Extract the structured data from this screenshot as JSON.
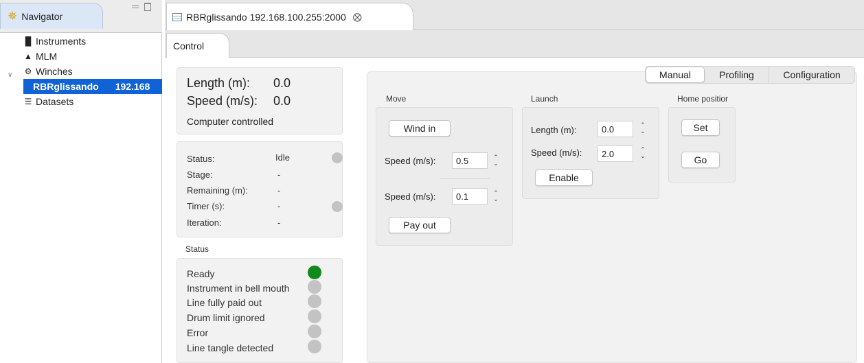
{
  "navigator": {
    "title": "Navigator",
    "items": [
      {
        "label": "Instruments",
        "icon": "bottle-icon"
      },
      {
        "label": "MLM",
        "icon": "scale-icon"
      },
      {
        "label": "Winches",
        "icon": "gears-icon"
      },
      {
        "label": "RBRglissando",
        "ip": "192.168"
      },
      {
        "label": "Datasets",
        "icon": "database-icon"
      }
    ]
  },
  "editor": {
    "tab_title": "RBRglissando 192.168.100.255:2000",
    "control_tab": "Control"
  },
  "readout": {
    "length_label": "Length (m):",
    "length_value": "0.0",
    "speed_label": "Speed (m/s):",
    "speed_value": "0.0",
    "mode": "Computer controlled"
  },
  "status": {
    "status_label": "Status:",
    "status_value": "Idle",
    "stage_label": "Stage:",
    "stage_value": "-",
    "remaining_label": "Remaining (m):",
    "remaining_value": "-",
    "timer_label": "Timer (s):",
    "timer_value": "-",
    "iteration_label": "Iteration:",
    "iteration_value": "-"
  },
  "flags": {
    "heading": "Status",
    "items": [
      {
        "label": "Ready",
        "color": "#118a1b"
      },
      {
        "label": "Instrument in bell mouth",
        "color": "#c3c3c3"
      },
      {
        "label": "Line fully paid out",
        "color": "#c3c3c3"
      },
      {
        "label": "Drum limit ignored",
        "color": "#c3c3c3"
      },
      {
        "label": "Error",
        "color": "#c3c3c3"
      },
      {
        "label": "Line tangle detected",
        "color": "#c3c3c3"
      }
    ]
  },
  "modes": [
    "Manual",
    "Profiling",
    "Configuration"
  ],
  "move": {
    "heading": "Move",
    "wind_in": "Wind in",
    "speed_label": "Speed (m/s):",
    "speed_in": "0.5",
    "speed_out": "0.1",
    "pay_out": "Pay out"
  },
  "launch": {
    "heading": "Launch",
    "length_label": "Length (m):",
    "length_value": "0.0",
    "speed_label": "Speed (m/s):",
    "speed_value": "2.0",
    "enable": "Enable"
  },
  "home": {
    "heading": "Home positior",
    "set": "Set",
    "go": "Go"
  }
}
